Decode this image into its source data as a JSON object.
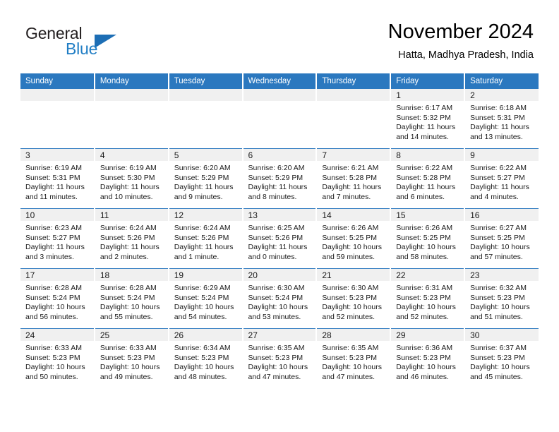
{
  "brand": {
    "name_part1": "General",
    "name_part2": "Blue",
    "accent_color": "#1d6eb5"
  },
  "header": {
    "month_title": "November 2024",
    "location": "Hatta, Madhya Pradesh, India"
  },
  "calendar": {
    "header_bg": "#2b78bf",
    "daynum_band_bg": "#f0f0f0",
    "weekday_headers": [
      "Sunday",
      "Monday",
      "Tuesday",
      "Wednesday",
      "Thursday",
      "Friday",
      "Saturday"
    ],
    "weeks": [
      [
        {
          "day": "",
          "empty": true
        },
        {
          "day": "",
          "empty": true
        },
        {
          "day": "",
          "empty": true
        },
        {
          "day": "",
          "empty": true
        },
        {
          "day": "",
          "empty": true
        },
        {
          "day": "1",
          "sunrise": "Sunrise: 6:17 AM",
          "sunset": "Sunset: 5:32 PM",
          "daylight_line1": "Daylight: 11 hours",
          "daylight_line2": "and 14 minutes."
        },
        {
          "day": "2",
          "sunrise": "Sunrise: 6:18 AM",
          "sunset": "Sunset: 5:31 PM",
          "daylight_line1": "Daylight: 11 hours",
          "daylight_line2": "and 13 minutes."
        }
      ],
      [
        {
          "day": "3",
          "sunrise": "Sunrise: 6:19 AM",
          "sunset": "Sunset: 5:31 PM",
          "daylight_line1": "Daylight: 11 hours",
          "daylight_line2": "and 11 minutes."
        },
        {
          "day": "4",
          "sunrise": "Sunrise: 6:19 AM",
          "sunset": "Sunset: 5:30 PM",
          "daylight_line1": "Daylight: 11 hours",
          "daylight_line2": "and 10 minutes."
        },
        {
          "day": "5",
          "sunrise": "Sunrise: 6:20 AM",
          "sunset": "Sunset: 5:29 PM",
          "daylight_line1": "Daylight: 11 hours",
          "daylight_line2": "and 9 minutes."
        },
        {
          "day": "6",
          "sunrise": "Sunrise: 6:20 AM",
          "sunset": "Sunset: 5:29 PM",
          "daylight_line1": "Daylight: 11 hours",
          "daylight_line2": "and 8 minutes."
        },
        {
          "day": "7",
          "sunrise": "Sunrise: 6:21 AM",
          "sunset": "Sunset: 5:28 PM",
          "daylight_line1": "Daylight: 11 hours",
          "daylight_line2": "and 7 minutes."
        },
        {
          "day": "8",
          "sunrise": "Sunrise: 6:22 AM",
          "sunset": "Sunset: 5:28 PM",
          "daylight_line1": "Daylight: 11 hours",
          "daylight_line2": "and 6 minutes."
        },
        {
          "day": "9",
          "sunrise": "Sunrise: 6:22 AM",
          "sunset": "Sunset: 5:27 PM",
          "daylight_line1": "Daylight: 11 hours",
          "daylight_line2": "and 4 minutes."
        }
      ],
      [
        {
          "day": "10",
          "sunrise": "Sunrise: 6:23 AM",
          "sunset": "Sunset: 5:27 PM",
          "daylight_line1": "Daylight: 11 hours",
          "daylight_line2": "and 3 minutes."
        },
        {
          "day": "11",
          "sunrise": "Sunrise: 6:24 AM",
          "sunset": "Sunset: 5:26 PM",
          "daylight_line1": "Daylight: 11 hours",
          "daylight_line2": "and 2 minutes."
        },
        {
          "day": "12",
          "sunrise": "Sunrise: 6:24 AM",
          "sunset": "Sunset: 5:26 PM",
          "daylight_line1": "Daylight: 11 hours",
          "daylight_line2": "and 1 minute."
        },
        {
          "day": "13",
          "sunrise": "Sunrise: 6:25 AM",
          "sunset": "Sunset: 5:26 PM",
          "daylight_line1": "Daylight: 11 hours",
          "daylight_line2": "and 0 minutes."
        },
        {
          "day": "14",
          "sunrise": "Sunrise: 6:26 AM",
          "sunset": "Sunset: 5:25 PM",
          "daylight_line1": "Daylight: 10 hours",
          "daylight_line2": "and 59 minutes."
        },
        {
          "day": "15",
          "sunrise": "Sunrise: 6:26 AM",
          "sunset": "Sunset: 5:25 PM",
          "daylight_line1": "Daylight: 10 hours",
          "daylight_line2": "and 58 minutes."
        },
        {
          "day": "16",
          "sunrise": "Sunrise: 6:27 AM",
          "sunset": "Sunset: 5:25 PM",
          "daylight_line1": "Daylight: 10 hours",
          "daylight_line2": "and 57 minutes."
        }
      ],
      [
        {
          "day": "17",
          "sunrise": "Sunrise: 6:28 AM",
          "sunset": "Sunset: 5:24 PM",
          "daylight_line1": "Daylight: 10 hours",
          "daylight_line2": "and 56 minutes."
        },
        {
          "day": "18",
          "sunrise": "Sunrise: 6:28 AM",
          "sunset": "Sunset: 5:24 PM",
          "daylight_line1": "Daylight: 10 hours",
          "daylight_line2": "and 55 minutes."
        },
        {
          "day": "19",
          "sunrise": "Sunrise: 6:29 AM",
          "sunset": "Sunset: 5:24 PM",
          "daylight_line1": "Daylight: 10 hours",
          "daylight_line2": "and 54 minutes."
        },
        {
          "day": "20",
          "sunrise": "Sunrise: 6:30 AM",
          "sunset": "Sunset: 5:24 PM",
          "daylight_line1": "Daylight: 10 hours",
          "daylight_line2": "and 53 minutes."
        },
        {
          "day": "21",
          "sunrise": "Sunrise: 6:30 AM",
          "sunset": "Sunset: 5:23 PM",
          "daylight_line1": "Daylight: 10 hours",
          "daylight_line2": "and 52 minutes."
        },
        {
          "day": "22",
          "sunrise": "Sunrise: 6:31 AM",
          "sunset": "Sunset: 5:23 PM",
          "daylight_line1": "Daylight: 10 hours",
          "daylight_line2": "and 52 minutes."
        },
        {
          "day": "23",
          "sunrise": "Sunrise: 6:32 AM",
          "sunset": "Sunset: 5:23 PM",
          "daylight_line1": "Daylight: 10 hours",
          "daylight_line2": "and 51 minutes."
        }
      ],
      [
        {
          "day": "24",
          "sunrise": "Sunrise: 6:33 AM",
          "sunset": "Sunset: 5:23 PM",
          "daylight_line1": "Daylight: 10 hours",
          "daylight_line2": "and 50 minutes."
        },
        {
          "day": "25",
          "sunrise": "Sunrise: 6:33 AM",
          "sunset": "Sunset: 5:23 PM",
          "daylight_line1": "Daylight: 10 hours",
          "daylight_line2": "and 49 minutes."
        },
        {
          "day": "26",
          "sunrise": "Sunrise: 6:34 AM",
          "sunset": "Sunset: 5:23 PM",
          "daylight_line1": "Daylight: 10 hours",
          "daylight_line2": "and 48 minutes."
        },
        {
          "day": "27",
          "sunrise": "Sunrise: 6:35 AM",
          "sunset": "Sunset: 5:23 PM",
          "daylight_line1": "Daylight: 10 hours",
          "daylight_line2": "and 47 minutes."
        },
        {
          "day": "28",
          "sunrise": "Sunrise: 6:35 AM",
          "sunset": "Sunset: 5:23 PM",
          "daylight_line1": "Daylight: 10 hours",
          "daylight_line2": "and 47 minutes."
        },
        {
          "day": "29",
          "sunrise": "Sunrise: 6:36 AM",
          "sunset": "Sunset: 5:23 PM",
          "daylight_line1": "Daylight: 10 hours",
          "daylight_line2": "and 46 minutes."
        },
        {
          "day": "30",
          "sunrise": "Sunrise: 6:37 AM",
          "sunset": "Sunset: 5:23 PM",
          "daylight_line1": "Daylight: 10 hours",
          "daylight_line2": "and 45 minutes."
        }
      ]
    ]
  }
}
